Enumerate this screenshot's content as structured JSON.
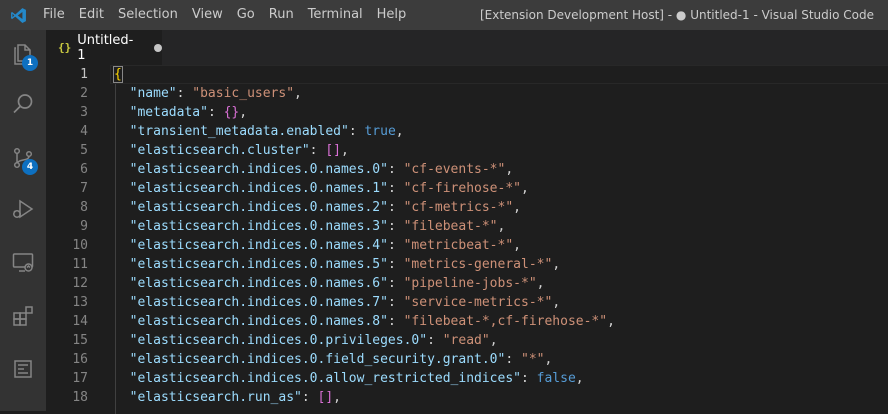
{
  "window_title": "[Extension Development Host] - ● Untitled-1 - Visual Studio Code",
  "menu": [
    "File",
    "Edit",
    "Selection",
    "View",
    "Go",
    "Run",
    "Terminal",
    "Help"
  ],
  "activity_bar": {
    "explorer_badge": "1",
    "source_control_badge": "4",
    "icons": [
      "files-icon",
      "search-icon",
      "source-control-icon",
      "run-debug-icon",
      "remote-explorer-icon",
      "extensions-icon",
      "notebook-icon"
    ]
  },
  "tab": {
    "icon": "{}",
    "label": "Untitled-1"
  },
  "editor": {
    "lines": [
      {
        "n": "1",
        "key": "",
        "val": ""
      },
      {
        "n": "2",
        "key": "\"name\"",
        "val": "\"basic_users\""
      },
      {
        "n": "3",
        "key": "\"metadata\"",
        "val": "{}"
      },
      {
        "n": "4",
        "key": "\"transient_metadata.enabled\"",
        "val": "true"
      },
      {
        "n": "5",
        "key": "\"elasticsearch.cluster\"",
        "val": "[]"
      },
      {
        "n": "6",
        "key": "\"elasticsearch.indices.0.names.0\"",
        "val": "\"cf-events-*\""
      },
      {
        "n": "7",
        "key": "\"elasticsearch.indices.0.names.1\"",
        "val": "\"cf-firehose-*\""
      },
      {
        "n": "8",
        "key": "\"elasticsearch.indices.0.names.2\"",
        "val": "\"cf-metrics-*\""
      },
      {
        "n": "9",
        "key": "\"elasticsearch.indices.0.names.3\"",
        "val": "\"filebeat-*\""
      },
      {
        "n": "10",
        "key": "\"elasticsearch.indices.0.names.4\"",
        "val": "\"metricbeat-*\""
      },
      {
        "n": "11",
        "key": "\"elasticsearch.indices.0.names.5\"",
        "val": "\"metrics-general-*\""
      },
      {
        "n": "12",
        "key": "\"elasticsearch.indices.0.names.6\"",
        "val": "\"pipeline-jobs-*\""
      },
      {
        "n": "13",
        "key": "\"elasticsearch.indices.0.names.7\"",
        "val": "\"service-metrics-*\""
      },
      {
        "n": "14",
        "key": "\"elasticsearch.indices.0.names.8\"",
        "val": "\"filebeat-*,cf-firehose-*\""
      },
      {
        "n": "15",
        "key": "\"elasticsearch.indices.0.privileges.0\"",
        "val": "\"read\""
      },
      {
        "n": "16",
        "key": "\"elasticsearch.indices.0.field_security.grant.0\"",
        "val": "\"*\""
      },
      {
        "n": "17",
        "key": "\"elasticsearch.indices.0.allow_restricted_indices\"",
        "val": "false"
      },
      {
        "n": "18",
        "key": "\"elasticsearch.run_as\"",
        "val": "[]"
      }
    ],
    "open_brace": "{"
  },
  "colors": {
    "titlebar": "#3c3c3c",
    "activitybar": "#333333",
    "editor_bg": "#1e1e1e",
    "badge": "#0e70c0",
    "json_key": "#9cdcfe",
    "json_string": "#ce9178",
    "json_keyword": "#569cd6"
  }
}
